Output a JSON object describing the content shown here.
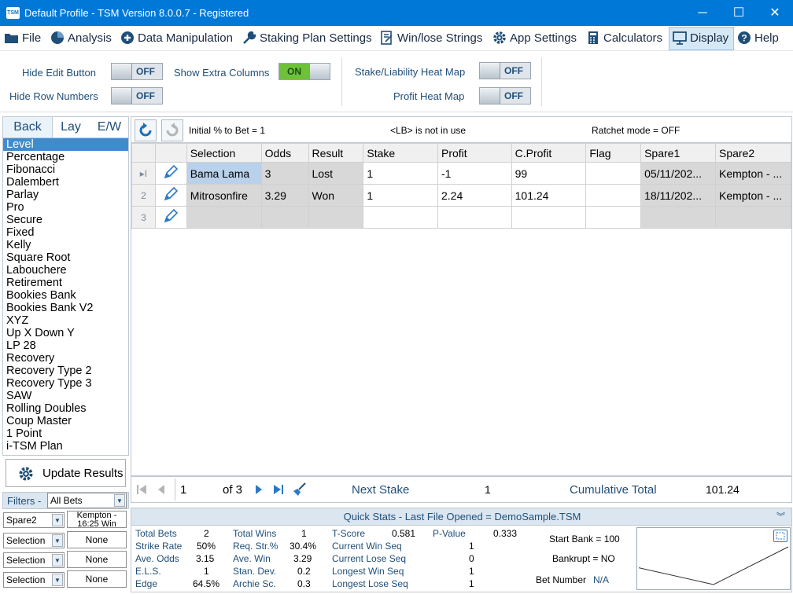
{
  "window": {
    "logo": "TSM",
    "title": "Default Profile  - TSM Version 8.0.0.7 - Registered",
    "controls": [
      "─",
      "☐",
      "✕"
    ]
  },
  "menu": [
    {
      "label": "File",
      "icon": "folder-icon"
    },
    {
      "label": "Analysis",
      "icon": "pie-chart-icon"
    },
    {
      "label": "Data Manipulation",
      "icon": "plus-circle-icon"
    },
    {
      "label": "Staking Plan Settings",
      "icon": "wrench-icon"
    },
    {
      "label": "Win/lose Strings",
      "icon": "document-edit-icon"
    },
    {
      "label": "App Settings",
      "icon": "gear-icon"
    },
    {
      "label": "Calculators",
      "icon": "calculator-icon"
    },
    {
      "label": "Display",
      "icon": "monitor-icon",
      "active": true
    },
    {
      "label": "Help",
      "icon": "help-icon"
    }
  ],
  "settings": {
    "hide_edit_button": {
      "label": "Hide Edit Button",
      "state": "OFF"
    },
    "hide_row_numbers": {
      "label": "Hide Row Numbers",
      "state": "OFF"
    },
    "show_extra_columns": {
      "label": "Show Extra Columns",
      "state": "ON"
    },
    "stake_heat_map": {
      "label": "Stake/Liability Heat Map",
      "state": "OFF"
    },
    "profit_heat_map": {
      "label": "Profit Heat Map",
      "state": "OFF"
    }
  },
  "tabs": [
    {
      "label": "Back",
      "active": true
    },
    {
      "label": "Lay",
      "active": false
    },
    {
      "label": "E/W",
      "active": false
    }
  ],
  "plans": [
    "Level",
    "Percentage",
    "Fibonacci",
    "Dalembert",
    "Parlay",
    "Pro",
    "Secure",
    "Fixed",
    "Kelly",
    "Square Root",
    "Labouchere",
    "Retirement",
    "Bookies Bank",
    "Bookies Bank V2",
    "XYZ",
    "Up X Down Y",
    "LP 28",
    "Recovery",
    "Recovery Type 2",
    "Recovery Type 3",
    "SAW",
    "Rolling Doubles",
    "Coup Master",
    "1 Point",
    "i-TSM Plan"
  ],
  "selected_plan": "Level",
  "update_button": "Update Results",
  "filters": {
    "label": "Filters -",
    "value": "All Bets",
    "rows": [
      {
        "field": "Spare2",
        "value": "Kempton - 16:25 Win"
      },
      {
        "field": "Selection",
        "value": "None"
      },
      {
        "field": "Selection",
        "value": "None"
      },
      {
        "field": "Selection",
        "value": "None"
      }
    ]
  },
  "toolbar": {
    "initial_pct": "Initial % to Bet = 1",
    "lb_status": "<LB> is not in use",
    "ratchet": "Ratchet mode = OFF"
  },
  "grid": {
    "columns": [
      "Selection",
      "Odds",
      "Result",
      "Stake",
      "Profit",
      "C.Profit",
      "Flag",
      "Spare1",
      "Spare2"
    ],
    "rows": [
      {
        "num": "1",
        "marker": "▸I",
        "cells": [
          "Bama Lama",
          "3",
          "Lost",
          "1",
          "-1",
          "99",
          "",
          "05/11/202...",
          "Kempton - ..."
        ]
      },
      {
        "num": "2",
        "marker": "2",
        "cells": [
          "Mitrosonfire",
          "3.29",
          "Won",
          "1",
          "2.24",
          "101.24",
          "",
          "18/11/202...",
          "Kempton - ..."
        ]
      },
      {
        "num": "3",
        "marker": "3",
        "cells": [
          "",
          "",
          "",
          "",
          "",
          "",
          "",
          "",
          ""
        ]
      }
    ]
  },
  "navigator": {
    "page": "1",
    "of": "of 3",
    "next_stake_label": "Next Stake",
    "next_stake_value": "1",
    "cumulative_label": "Cumulative Total",
    "cumulative_value": "101.24"
  },
  "quick_stats": {
    "header": "Quick Stats - Last File Opened = DemoSample.TSM",
    "col1": [
      {
        "label": "Total Bets",
        "value": "2"
      },
      {
        "label": "Strike Rate",
        "value": "50%"
      },
      {
        "label": "Ave. Odds",
        "value": "3.15"
      },
      {
        "label": "E.L.S.",
        "value": "1"
      },
      {
        "label": "Edge",
        "value": "64.5%"
      }
    ],
    "col2": [
      {
        "label": "Total Wins",
        "value": "1"
      },
      {
        "label": "Req. Str.%",
        "value": "30.4%"
      },
      {
        "label": "Ave. Win",
        "value": "3.29"
      },
      {
        "label": "Stan. Dev.",
        "value": "0.2"
      },
      {
        "label": "Archie Sc.",
        "value": "0.3"
      }
    ],
    "col3": [
      {
        "label": "T-Score",
        "value": "0.581"
      },
      {
        "label": "Current Win Seq",
        "value": "1"
      },
      {
        "label": "Current Lose Seq",
        "value": "0"
      },
      {
        "label": "Longest Win Seq",
        "value": "1"
      },
      {
        "label": "Longest Lose Seq",
        "value": "1"
      }
    ],
    "pvalue": {
      "label": "P-Value",
      "value": "0.333"
    },
    "start_bank": "Start Bank = 100",
    "bankrupt": "Bankrupt = NO",
    "bet_number_label": "Bet Number",
    "bet_number_value": "N/A"
  },
  "chart_data": {
    "type": "line",
    "x": [
      0,
      1,
      2
    ],
    "y": [
      100,
      99,
      101.24
    ],
    "title": "",
    "xlabel": "",
    "ylabel": ""
  },
  "colors": {
    "titlebar": "#0078d7",
    "accent_text": "#1f4e79",
    "selected": "#3f8bd0",
    "toggle_on": "#6dc23a"
  }
}
